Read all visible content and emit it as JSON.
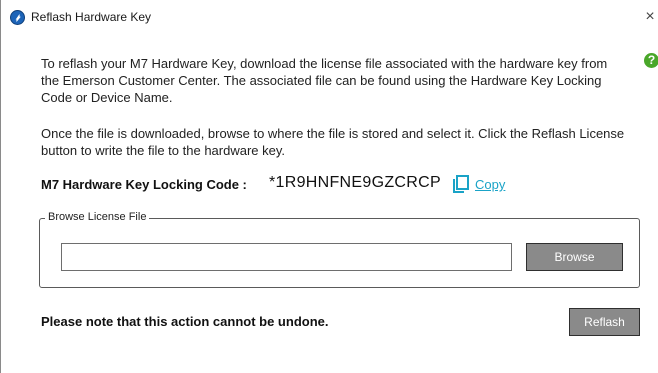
{
  "window": {
    "title": "Reflash Hardware Key",
    "close_glyph": "×",
    "app_icon": "emerson-logo-icon"
  },
  "help": {
    "icon": "question-circle-icon",
    "glyph": "?"
  },
  "instructions": {
    "paragraph1": "To reflash your M7 Hardware Key, download the license file associated with the hardware key from the Emerson Customer Center. The associated file can be found using the Hardware Key Locking Code or Device Name.",
    "paragraph2": "Once the file is downloaded, browse to where the file is stored and select it. Click the Reflash License button to write the file to the hardware key."
  },
  "locking_code": {
    "label": "M7 Hardware Key Locking Code :",
    "value": "*1R9HNFNE9GZCRCP",
    "copy_icon": "copy-icon",
    "copy_label": "Copy"
  },
  "browse_group": {
    "legend": "Browse License File",
    "input_value": "",
    "browse_label": "Browse"
  },
  "footer": {
    "warning": "Please note that this action cannot be undone.",
    "reflash_label": "Reflash"
  },
  "colors": {
    "copy_accent": "#1aa3c7",
    "help_green": "#4aa72a",
    "button_gray": "#8a8a8a"
  }
}
